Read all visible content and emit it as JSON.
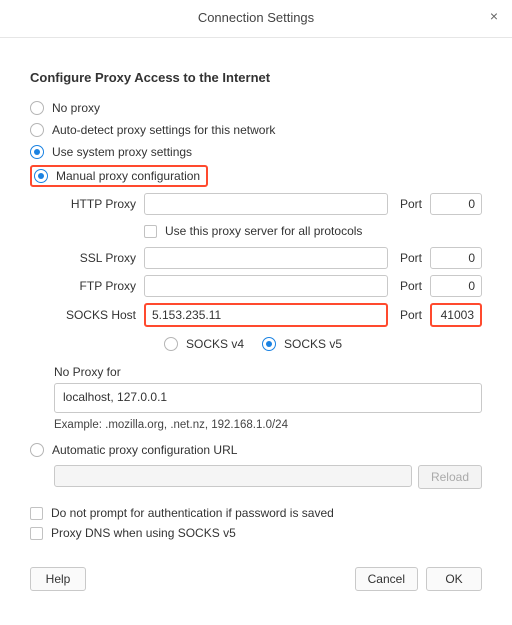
{
  "title": "Connection Settings",
  "section": "Configure Proxy Access to the Internet",
  "options": {
    "no_proxy": "No proxy",
    "auto_detect": "Auto-detect proxy settings for this network",
    "system": "Use system proxy settings",
    "manual": "Manual proxy configuration",
    "auto_url": "Automatic proxy configuration URL"
  },
  "labels": {
    "http": "HTTP Proxy",
    "ssl": "SSL Proxy",
    "ftp": "FTP Proxy",
    "socks": "SOCKS Host",
    "port": "Port",
    "use_all": "Use this proxy server for all protocols",
    "socks_v4": "SOCKS v4",
    "socks_v5": "SOCKS v5",
    "noproxy_for": "No Proxy for",
    "example": "Example: .mozilla.org, .net.nz, 192.168.1.0/24",
    "reload": "Reload",
    "no_prompt": "Do not prompt for authentication if password is saved",
    "proxy_dns": "Proxy DNS when using SOCKS v5"
  },
  "values": {
    "http_host": "",
    "http_port": "0",
    "ssl_host": "",
    "ssl_port": "0",
    "ftp_host": "",
    "ftp_port": "0",
    "socks_host": "5.153.235.11",
    "socks_port": "41003",
    "noproxy": "localhost, 127.0.0.1",
    "auto_url": ""
  },
  "buttons": {
    "help": "Help",
    "cancel": "Cancel",
    "ok": "OK"
  }
}
